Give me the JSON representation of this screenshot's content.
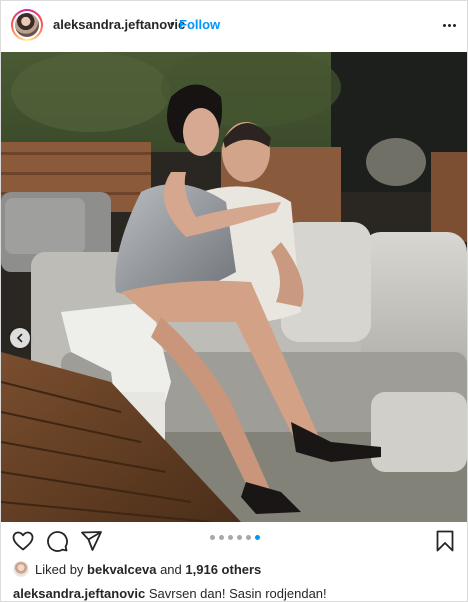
{
  "header": {
    "username": "aleksandra.jeftanovic",
    "separator": "•",
    "follow_label": "Follow",
    "avatar_icon": "profile-avatar",
    "more_icon": "more-options-icon"
  },
  "media": {
    "carousel_total": 6,
    "carousel_active": 6,
    "prev_icon": "chevron-left-icon",
    "expand_icon": "external-link-icon"
  },
  "actions": {
    "like_icon": "heart-icon",
    "comment_icon": "comment-icon",
    "share_icon": "paper-plane-icon",
    "save_icon": "bookmark-icon"
  },
  "likes": {
    "prefix": "Liked by",
    "user": "bekvalceva",
    "joiner": "and",
    "others": "1,916 others"
  },
  "caption": {
    "username": "aleksandra.jeftanovic",
    "text": "Savrsen dan! Sasin rodjendan!"
  },
  "colors": {
    "accent": "#0095f6",
    "text": "#262626",
    "border": "#dbdbdb"
  }
}
